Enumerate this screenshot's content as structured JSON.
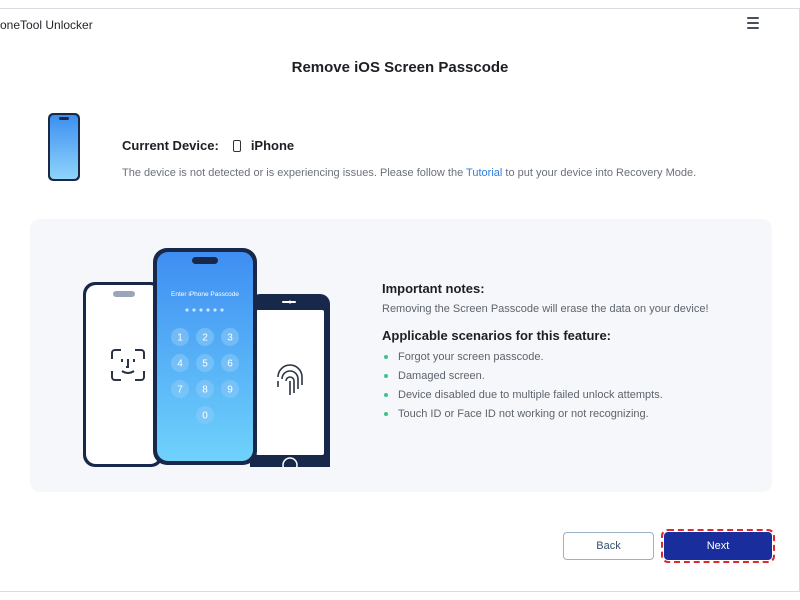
{
  "window": {
    "title": "oneTool Unlocker"
  },
  "page": {
    "title": "Remove iOS Screen Passcode"
  },
  "device": {
    "label": "Current Device:",
    "name": "iPhone",
    "hint_before": "The device is not detected or is experiencing issues. Please follow the ",
    "hint_link": "Tutorial",
    "hint_after": " to put your device into Recovery Mode."
  },
  "illustration": {
    "passcode_prompt": "Enter iPhone Passcode",
    "keys": [
      "1",
      "2",
      "3",
      "4",
      "5",
      "6",
      "7",
      "8",
      "9",
      "0"
    ]
  },
  "notes": {
    "important_title": "Important notes:",
    "important_text": "Removing the Screen Passcode will erase the data on your device!",
    "scenarios_title": "Applicable scenarios for this feature:",
    "scenarios": [
      "Forgot your screen passcode.",
      "Damaged screen.",
      "Device disabled due to multiple failed unlock attempts.",
      "Touch ID or Face ID not working or not recognizing."
    ]
  },
  "buttons": {
    "back": "Back",
    "next": "Next"
  },
  "colors": {
    "accent": "#1a2d9c",
    "link": "#2f7fe0",
    "bullet": "#3bc48a",
    "phone_blue": "#4aa8f5"
  }
}
